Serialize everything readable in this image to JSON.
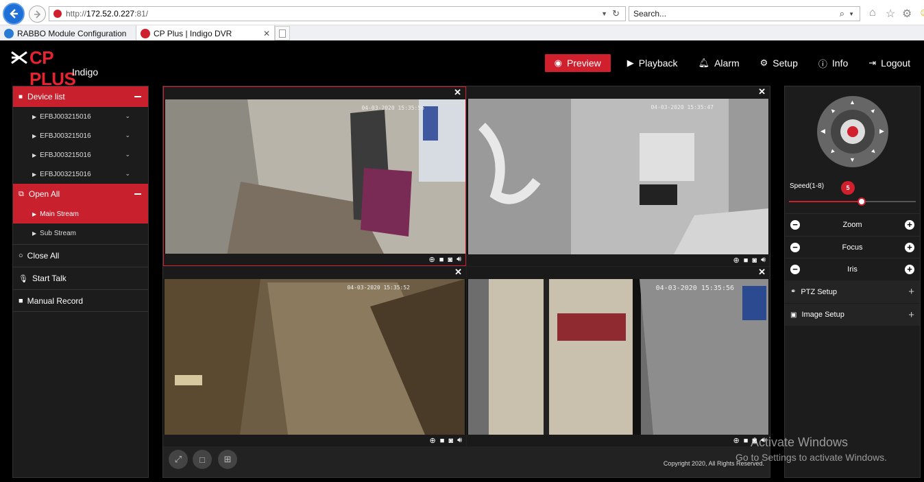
{
  "browser": {
    "address": {
      "proto": "http://",
      "host": "172.52.0.227",
      "port": ":81/"
    },
    "search_placeholder": "Search...",
    "tabs": [
      {
        "label": "RABBO Module Configuration"
      },
      {
        "label": "CP Plus | Indigo DVR"
      }
    ]
  },
  "app": {
    "brand": "CP PLUS",
    "subbrand": "Indigo",
    "nav": [
      {
        "label": "Preview",
        "icon": "eye-icon"
      },
      {
        "label": "Playback",
        "icon": "play-icon"
      },
      {
        "label": "Alarm",
        "icon": "bell-icon"
      },
      {
        "label": "Setup",
        "icon": "gear-icon"
      },
      {
        "label": "Info",
        "icon": "info-icon"
      },
      {
        "label": "Logout",
        "icon": "logout-icon"
      }
    ]
  },
  "left_panel": {
    "device_list_label": "Device list",
    "devices": [
      "EFBJ003215016",
      "EFBJ003215016",
      "EFBJ003215016",
      "EFBJ003215016"
    ],
    "open_all_label": "Open All",
    "streams": [
      "Main Stream",
      "Sub Stream"
    ],
    "close_all_label": "Close All",
    "start_talk_label": "Start Talk",
    "manual_record_label": "Manual Record"
  },
  "cameras": [
    {
      "timestamp": "04-03-2020 15:35:56"
    },
    {
      "timestamp": "04-03-2020 15:35:47"
    },
    {
      "timestamp": "04-03-2020 15:35:52"
    },
    {
      "timestamp": "04-03-2020 15:35:56"
    }
  ],
  "copyright": "Copyright 2020, All Rights Reserved.",
  "right_panel": {
    "speed_label": "Speed(1-8)",
    "speed_value": "5",
    "speed_fraction": 0.571,
    "zoom_label": "Zoom",
    "focus_label": "Focus",
    "iris_label": "Iris",
    "ptz_setup_label": "PTZ Setup",
    "image_setup_label": "Image Setup"
  },
  "watermark": {
    "line1": "Activate Windows",
    "line2": "Go to Settings to activate Windows."
  },
  "colors": {
    "accent": "#d0202e",
    "panel": "#1c1c1c"
  }
}
